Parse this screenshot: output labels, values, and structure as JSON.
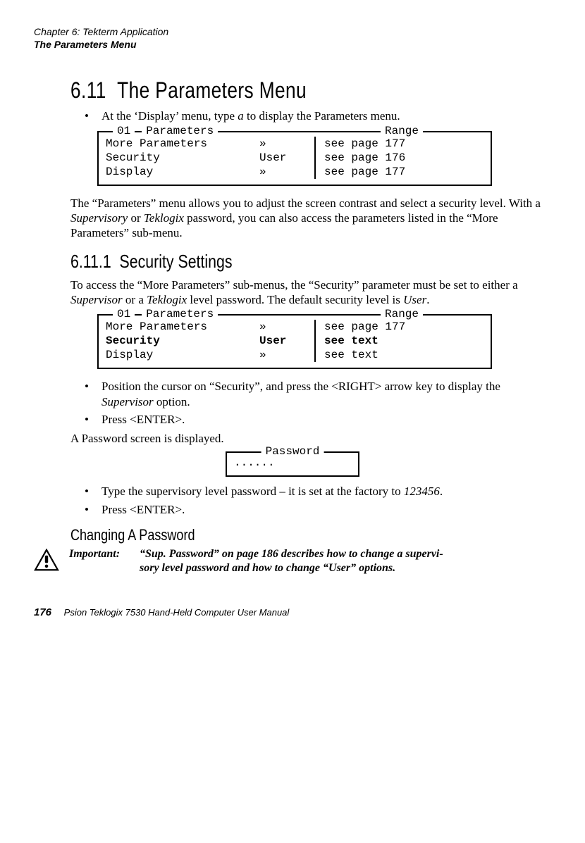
{
  "header": {
    "chapter": "Chapter 6: Tekterm Application",
    "section_name": "The Parameters Menu"
  },
  "h1": {
    "num": "6.11",
    "title": "The Parameters Menu"
  },
  "bullet_intro": "At the 'Display' menu, type a to display the Parameters menu.",
  "menu1": {
    "legend_left": "01",
    "legend_mid": "Parameters",
    "legend_right": "Range",
    "rows": [
      {
        "name": "More Parameters",
        "val": "»",
        "range": "see page 177"
      },
      {
        "name": "Security",
        "val": "User",
        "range": "see page 176"
      },
      {
        "name": "Display",
        "val": "»",
        "range": "see page 177"
      }
    ]
  },
  "para1": "The \"Parameters\" menu allows you to adjust the screen contrast and select a security level. With a Supervisory or Teklogix password, you can also access the parameters listed in the \"More Parameters\" sub-menu.",
  "h2": {
    "num": "6.11.1",
    "title": "Security Settings"
  },
  "para2": "To access the \"More Parameters\" sub-menus, the \"Security\" parameter must be set to either a Supervisor or a Teklogix level password. The default security level is User.",
  "menu2": {
    "legend_left": "01",
    "legend_mid": "Parameters",
    "legend_right": "Range",
    "rows": [
      {
        "name": "More Parameters",
        "val": "»",
        "range": "see page 177",
        "bold": false
      },
      {
        "name": "Security",
        "val": "User",
        "range": "see text",
        "bold": true
      },
      {
        "name": "Display",
        "val": "»",
        "range": "see text",
        "bold": false
      }
    ]
  },
  "bullets2": [
    "Position the cursor on \"Security\", and press the <RIGHT> arrow key to display the Supervisor option.",
    "Press <ENTER>."
  ],
  "para3": "A Password screen is displayed.",
  "pw": {
    "legend": "Password",
    "dots": "......"
  },
  "bullets3": [
    "Type the supervisory level password – it is set at the factory to 123456.",
    "Press <ENTER>."
  ],
  "h3": "Changing A Password",
  "important": {
    "label": "Important:",
    "msg": "\"Sup. Password\" on page 186 describes how to change a supervisory level password and how to change \"User\" options."
  },
  "footer": {
    "page": "176",
    "book": "Psion Teklogix 7530 Hand-Held Computer User Manual"
  }
}
